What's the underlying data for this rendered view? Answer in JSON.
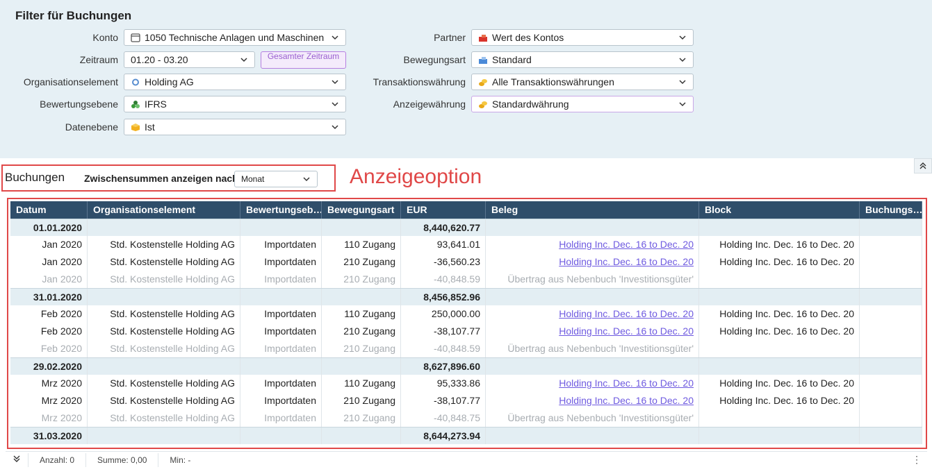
{
  "filter": {
    "title": "Filter für Buchungen",
    "left": [
      {
        "label": "Konto",
        "value": "1050 Technische Anlagen und Maschinen",
        "icon": "window-icon"
      },
      {
        "label": "Zeitraum",
        "value": "01.20 - 03.20",
        "icon": ""
      },
      {
        "label": "Organisationselement",
        "value": "Holding AG",
        "icon": "circle-icon"
      },
      {
        "label": "Bewertungsebene",
        "value": "IFRS",
        "icon": "dice-icon"
      },
      {
        "label": "Datenebene",
        "value": "Ist",
        "icon": "cube-icon"
      }
    ],
    "gesamt_label": "Gesamter Zeitraum",
    "right": [
      {
        "label": "Partner",
        "value": "Wert des Kontos",
        "icon": "partner-icon"
      },
      {
        "label": "Bewegungsart",
        "value": "Standard",
        "icon": "movement-icon"
      },
      {
        "label": "Transaktionswährung",
        "value": "Alle Transaktionswährungen",
        "icon": "coins-icon"
      },
      {
        "label": "Anzeigewährung",
        "value": "Standardwährung",
        "icon": "coins-icon"
      }
    ]
  },
  "buchungen": {
    "title": "Buchungen",
    "subtotal_label": "Zwischensummen anzeigen nach",
    "subtotal_value": "Monat",
    "annotation": "Anzeigeoption"
  },
  "table": {
    "columns": [
      "Datum",
      "Organisationselement",
      "Bewertungseb…",
      "Bewegungsart",
      "EUR",
      "Beleg",
      "Block",
      "Buchungs…"
    ],
    "rows": [
      {
        "type": "sum",
        "cells": [
          "01.01.2020",
          "",
          "",
          "",
          "8,440,620.77",
          "",
          "",
          ""
        ]
      },
      {
        "type": "row",
        "cells": [
          "Jan 2020",
          "Std. Kostenstelle Holding AG",
          "Importdaten",
          "110 Zugang",
          "93,641.01",
          "Holding Inc. Dec. 16 to Dec. 20",
          "Holding Inc. Dec. 16 to Dec. 20",
          ""
        ]
      },
      {
        "type": "row",
        "cells": [
          "Jan 2020",
          "Std. Kostenstelle Holding AG",
          "Importdaten",
          "210 Zugang",
          "-36,560.23",
          "Holding Inc. Dec. 16 to Dec. 20",
          "Holding Inc. Dec. 16 to Dec. 20",
          ""
        ]
      },
      {
        "type": "grey",
        "cells": [
          "Jan 2020",
          "Std. Kostenstelle Holding AG",
          "Importdaten",
          "210 Zugang",
          "-40,848.59",
          "Übertrag aus Nebenbuch 'Investitionsgüter'",
          "",
          ""
        ]
      },
      {
        "type": "sum",
        "cells": [
          "31.01.2020",
          "",
          "",
          "",
          "8,456,852.96",
          "",
          "",
          ""
        ]
      },
      {
        "type": "row",
        "cells": [
          "Feb 2020",
          "Std. Kostenstelle Holding AG",
          "Importdaten",
          "110 Zugang",
          "250,000.00",
          "Holding Inc. Dec. 16 to Dec. 20",
          "Holding Inc. Dec. 16 to Dec. 20",
          ""
        ]
      },
      {
        "type": "row",
        "cells": [
          "Feb 2020",
          "Std. Kostenstelle Holding AG",
          "Importdaten",
          "210 Zugang",
          "-38,107.77",
          "Holding Inc. Dec. 16 to Dec. 20",
          "Holding Inc. Dec. 16 to Dec. 20",
          ""
        ]
      },
      {
        "type": "grey",
        "cells": [
          "Feb 2020",
          "Std. Kostenstelle Holding AG",
          "Importdaten",
          "210 Zugang",
          "-40,848.59",
          "Übertrag aus Nebenbuch 'Investitionsgüter'",
          "",
          ""
        ]
      },
      {
        "type": "sum",
        "cells": [
          "29.02.2020",
          "",
          "",
          "",
          "8,627,896.60",
          "",
          "",
          ""
        ]
      },
      {
        "type": "row",
        "cells": [
          "Mrz 2020",
          "Std. Kostenstelle Holding AG",
          "Importdaten",
          "110 Zugang",
          "95,333.86",
          "Holding Inc. Dec. 16 to Dec. 20",
          "Holding Inc. Dec. 16 to Dec. 20",
          ""
        ]
      },
      {
        "type": "row",
        "cells": [
          "Mrz 2020",
          "Std. Kostenstelle Holding AG",
          "Importdaten",
          "210 Zugang",
          "-38,107.77",
          "Holding Inc. Dec. 16 to Dec. 20",
          "Holding Inc. Dec. 16 to Dec. 20",
          ""
        ]
      },
      {
        "type": "grey",
        "cells": [
          "Mrz 2020",
          "Std. Kostenstelle Holding AG",
          "Importdaten",
          "210 Zugang",
          "-40,848.75",
          "Übertrag aus Nebenbuch 'Investitionsgüter'",
          "",
          ""
        ]
      },
      {
        "type": "sum",
        "cells": [
          "31.03.2020",
          "",
          "",
          "",
          "8,644,273.94",
          "",
          "",
          ""
        ]
      }
    ]
  },
  "footer": {
    "anzahl": "Anzahl: 0",
    "summe": "Summe: 0,00",
    "min": "Min: -"
  },
  "colors": {
    "header": "#2f4e6a",
    "accent_red": "#e04848",
    "link": "#6e5ae0",
    "filter_bg": "#e6f0f5"
  }
}
